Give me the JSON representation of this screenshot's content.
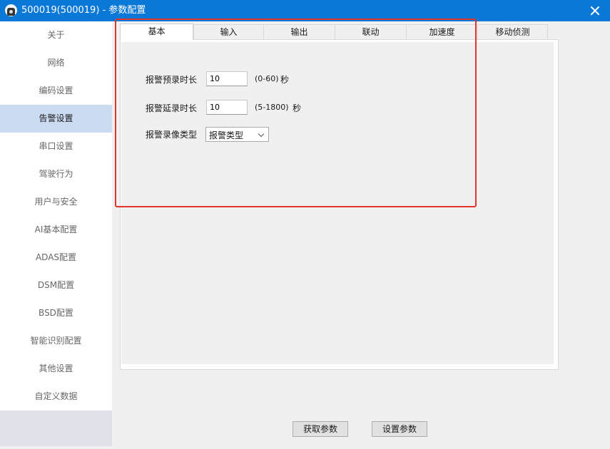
{
  "window": {
    "title": "500019(500019) - 参数配置",
    "icon": "camera-app-icon",
    "close_icon": "close-icon"
  },
  "sidebar": {
    "active_index": 3,
    "active_color": "#cbdcf2",
    "items": [
      {
        "label": "关于"
      },
      {
        "label": "网络"
      },
      {
        "label": "编码设置"
      },
      {
        "label": "告警设置"
      },
      {
        "label": "串口设置"
      },
      {
        "label": "驾驶行为"
      },
      {
        "label": "用户与安全"
      },
      {
        "label": "AI基本配置"
      },
      {
        "label": "ADAS配置"
      },
      {
        "label": "DSM配置"
      },
      {
        "label": "BSD配置"
      },
      {
        "label": "智能识别配置"
      },
      {
        "label": "其他设置"
      },
      {
        "label": "自定义数据"
      }
    ]
  },
  "tabs": {
    "active_index": 0,
    "items": [
      {
        "label": "基本"
      },
      {
        "label": "输入"
      },
      {
        "label": "输出"
      },
      {
        "label": "联动"
      },
      {
        "label": "加速度"
      },
      {
        "label": "移动侦测"
      }
    ]
  },
  "basic": {
    "pre_record": {
      "label": "报警预录时长",
      "value": "10",
      "range": "(0-60)",
      "unit": "秒"
    },
    "post_record": {
      "label": "报警延录时长",
      "value": "10",
      "range": "(5-1800)",
      "unit": "秒"
    },
    "record_type": {
      "label": "报警录像类型",
      "selected": "报警类型"
    }
  },
  "buttons": {
    "get_params": "获取参数",
    "set_params": "设置参数"
  },
  "colors": {
    "titlebar": "#0a78d7",
    "highlight": "#e0342f"
  }
}
